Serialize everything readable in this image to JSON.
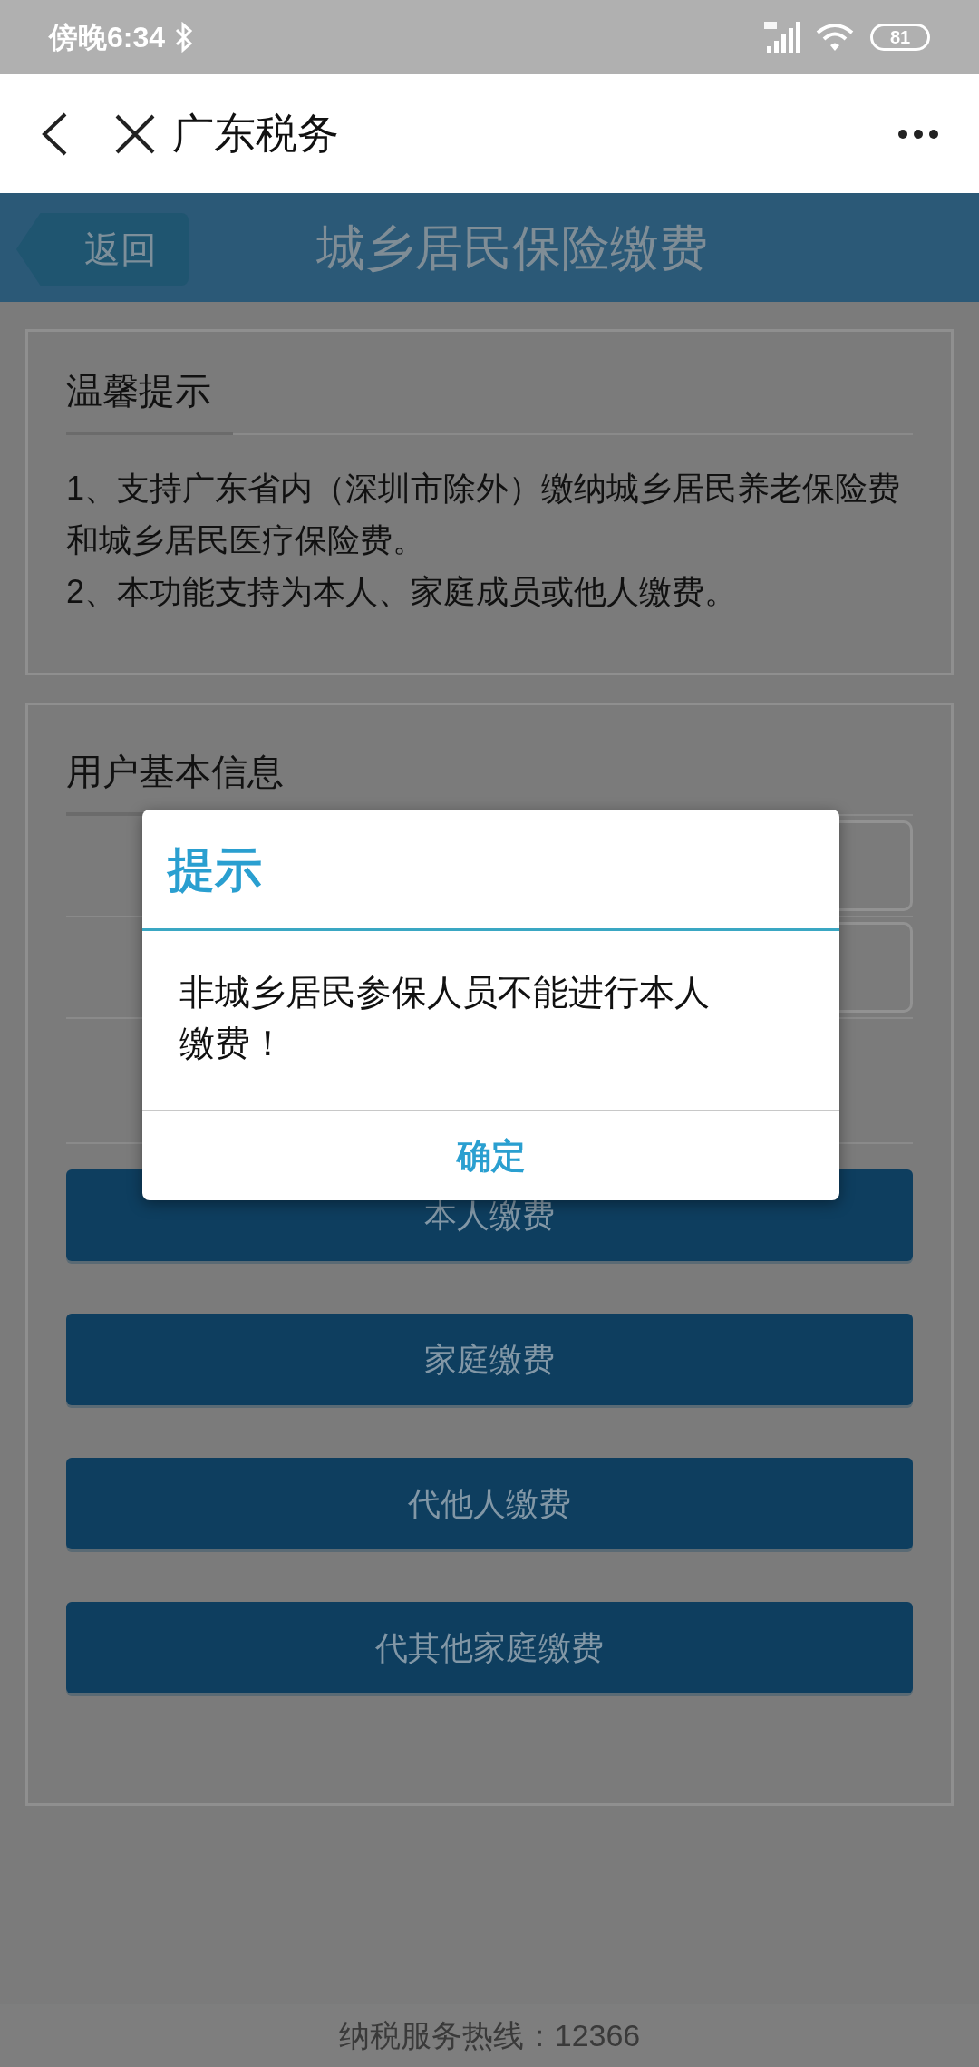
{
  "status_bar": {
    "time": "傍晚6:34",
    "battery": "81"
  },
  "nav": {
    "title": "广东税务"
  },
  "header": {
    "back": "返回",
    "title": "城乡居民保险缴费"
  },
  "notice": {
    "title": "温馨提示",
    "lines": [
      "1、支持广东省内（深圳市除外）缴纳城乡居民养老保险费和城乡居民医疗保险费。",
      "2、本功能支持为本人、家庭成员或他人缴费。"
    ]
  },
  "user_info": {
    "title": "用户基本信息"
  },
  "buttons": [
    "本人缴费",
    "家庭缴费",
    "代他人缴费",
    "代其他家庭缴费"
  ],
  "dialog": {
    "title": "提示",
    "message": "非城乡居民参保人员不能进行本人缴费！",
    "button": "确定"
  },
  "footer": "纳税服务热线：12366"
}
